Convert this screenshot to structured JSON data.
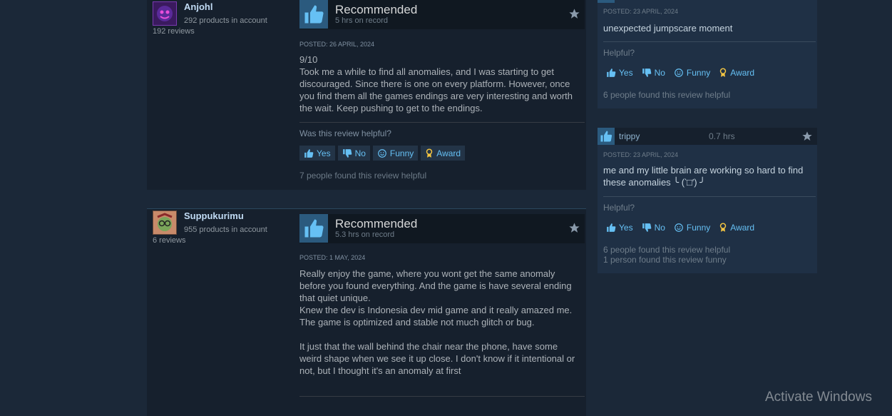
{
  "reviews": [
    {
      "author": "Anjohl",
      "products": "292 products in account",
      "reviews_count": "192 reviews",
      "verdict": "Recommended",
      "hours": "5 hrs on record",
      "posted": "POSTED: 26 APRIL, 2024",
      "content": "9/10\nTook me a while to find all anomalies, and I was starting to get discouraged. Since there is one on every platform. However, once you find them all the games endings are very interesting and worth the wait. Keep pushing to get to the endings.",
      "helpful_question": "Was this review helpful?",
      "yes_label": "Yes",
      "no_label": "No",
      "funny_label": "Funny",
      "award_label": "Award",
      "found_helpful": "7 people found this review helpful"
    },
    {
      "author": "Suppukurimu",
      "products": "955 products in account",
      "reviews_count": "6 reviews",
      "verdict": "Recommended",
      "hours": "5.3 hrs on record",
      "posted": "POSTED: 1 MAY, 2024",
      "content": "Really enjoy the game, where you wont get the same anomaly before you found everything. And the game is have several ending that quiet unique.\nKnew the dev is Indonesia dev mid game and it really amazed me.\nThe game is optimized and stable not much glitch or bug.\n\nIt just that the wall behind the chair near the phone, have some weird shape when we see it up close. I don't know if it intentional or not, but I thought it's an anomaly at first"
    }
  ],
  "side_reviews": [
    {
      "posted": "POSTED: 23 APRIL, 2024",
      "content": "unexpected jumpscare moment",
      "helpful_question": "Helpful?",
      "yes_label": "Yes",
      "no_label": "No",
      "funny_label": "Funny",
      "award_label": "Award",
      "found_helpful": "6 people found this review helpful"
    },
    {
      "author": "trippy",
      "hours": "0.7 hrs",
      "posted": "POSTED: 23 APRIL, 2024",
      "content": "me and my little brain are working so hard to find these anomalies ╰ (‵□′) ╯",
      "helpful_question": "Helpful?",
      "yes_label": "Yes",
      "no_label": "No",
      "funny_label": "Funny",
      "award_label": "Award",
      "found_helpful": "6 people found this review helpful",
      "found_funny": "1 person found this review funny"
    }
  ],
  "watermark": "Activate Windows",
  "colors": {
    "background": "#1b2838",
    "link": "#66c0f4",
    "award": "#f4c542",
    "thumb_bg": "#2b5a7e"
  },
  "icons": {
    "thumb": "thumbs-up-icon",
    "star": "star-icon",
    "yes": "thumbs-up-icon",
    "no": "thumbs-down-icon",
    "funny": "smiley-icon",
    "award": "award-ribbon-icon"
  }
}
